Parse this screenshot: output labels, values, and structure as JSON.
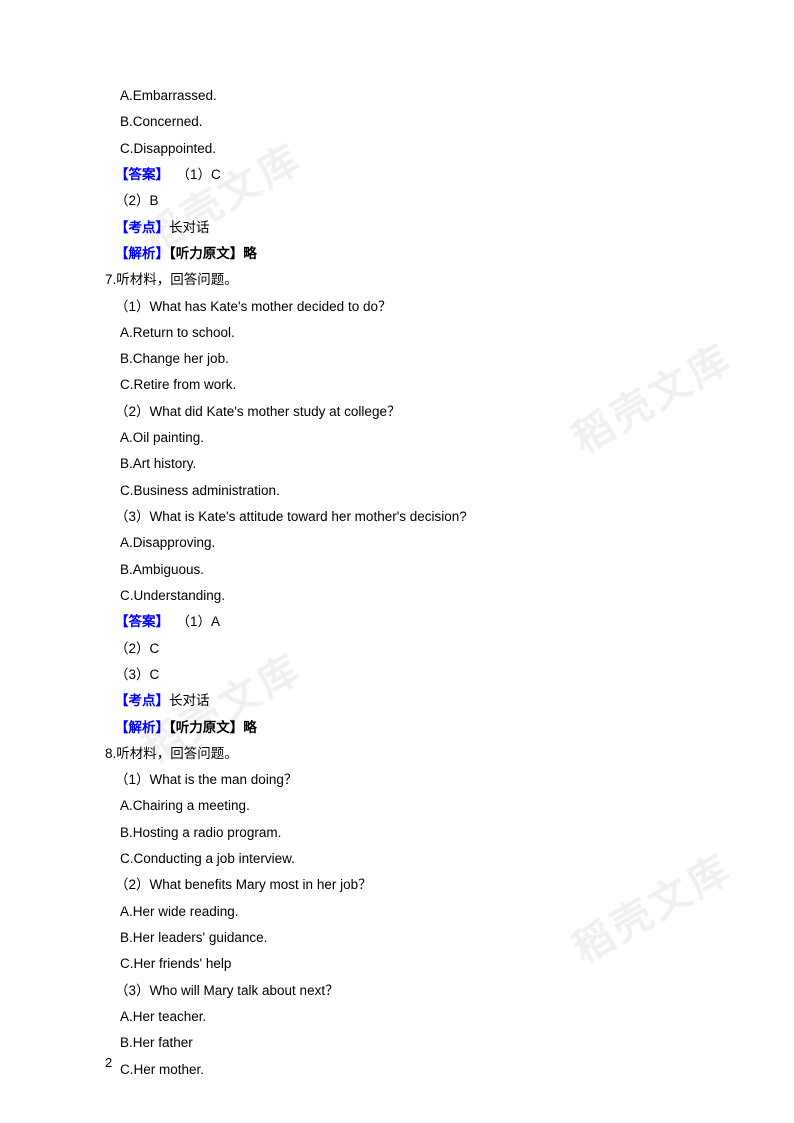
{
  "watermarks": [
    "稻壳文库",
    "稻壳文库",
    "稻壳文库",
    "稻壳文库"
  ],
  "q6": {
    "options": {
      "a": "A.Embarrassed.",
      "b": "B.Concerned.",
      "c": "C.Disappointed."
    },
    "answerLabel": "【答案】",
    "answers": {
      "a1": "（1）C",
      "a2": "（2）B"
    },
    "topicLabel": "【考点】",
    "topic": "长对话",
    "analysisLabel": "【解析】",
    "analysisContent": "【听力原文】略"
  },
  "q7": {
    "prompt": "7.听材料，回答问题。",
    "sub1": {
      "q": "（1）What has Kate's mother decided to do？",
      "a": "A.Return to school.",
      "b": "B.Change her job.",
      "c": "C.Retire from work."
    },
    "sub2": {
      "q": "（2）What did Kate's mother study at college？",
      "a": "A.Oil painting.",
      "b": "B.Art history.",
      "c": "C.Business administration."
    },
    "sub3": {
      "q": "（3）What is Kate's attitude toward her mother's decision?",
      "a": "A.Disapproving.",
      "b": "B.Ambiguous.",
      "c": "C.Understanding."
    },
    "answerLabel": "【答案】",
    "answers": {
      "a1": "（1）A",
      "a2": "（2）C",
      "a3": "（3）C"
    },
    "topicLabel": "【考点】",
    "topic": "长对话",
    "analysisLabel": "【解析】",
    "analysisContent": "【听力原文】略"
  },
  "q8": {
    "prompt": "8.听材料，回答问题。",
    "sub1": {
      "q": "（1）What is the man doing？",
      "a": "A.Chairing a meeting.",
      "b": "B.Hosting a radio program.",
      "c": "C.Conducting a job interview."
    },
    "sub2": {
      "q": "（2）What benefits Mary most in her job？",
      "a": "A.Her wide reading.",
      "b": "B.Her leaders' guidance.",
      "c": "C.Her friends' help"
    },
    "sub3": {
      "q": "（3）Who will Mary talk about next？",
      "a": "A.Her teacher.",
      "b": "B.Her father",
      "c": "C.Her mother."
    }
  },
  "pageNumber": "2"
}
